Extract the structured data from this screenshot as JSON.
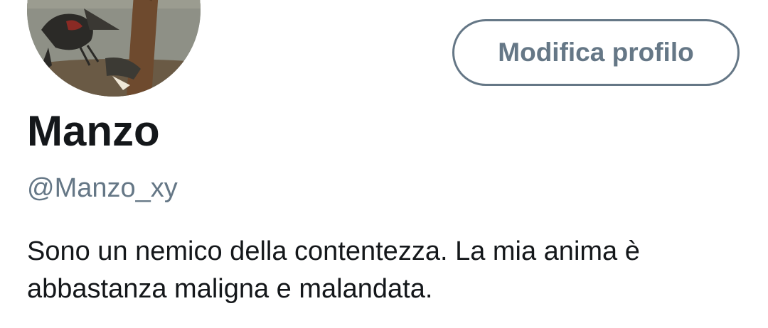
{
  "profile": {
    "edit_button_label": "Modifica profilo",
    "display_name": "Manzo",
    "handle": "@Manzo_xy",
    "bio": "Sono un nemico della contentezza. La mia anima è abbastanza maligna e malandata.",
    "avatar_icon": "profile-avatar-image"
  },
  "colors": {
    "text_primary": "#14171a",
    "text_secondary": "#657786",
    "button_border": "#657786",
    "background": "#ffffff"
  }
}
